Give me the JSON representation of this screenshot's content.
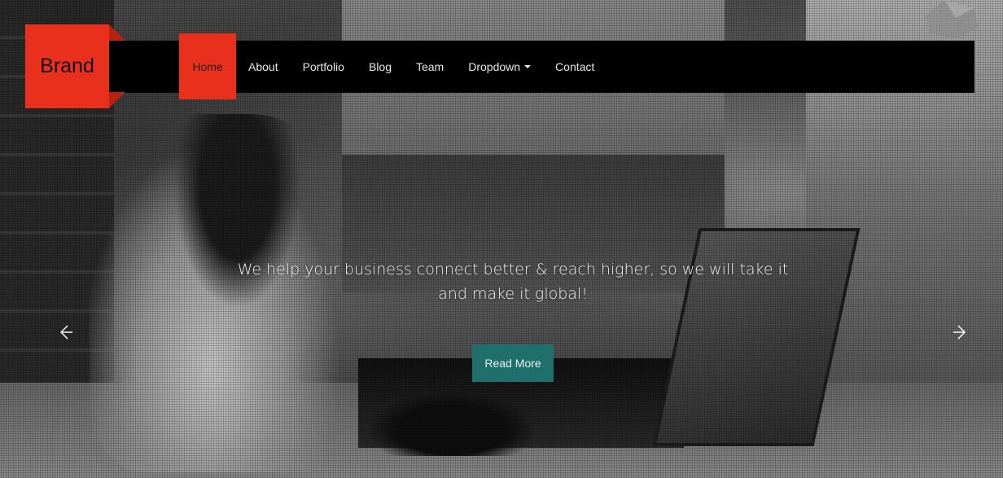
{
  "brand": {
    "label": "Brand",
    "color": "#e8301c"
  },
  "nav": {
    "items": [
      {
        "label": "Home",
        "active": true
      },
      {
        "label": "About",
        "active": false
      },
      {
        "label": "Portfolio",
        "active": false
      },
      {
        "label": "Blog",
        "active": false
      },
      {
        "label": "Team",
        "active": false
      },
      {
        "label": "Dropdown",
        "active": false,
        "has_caret": true
      },
      {
        "label": "Contact",
        "active": false
      }
    ]
  },
  "hero": {
    "caption": "We help your business connect better & reach higher, so we will take it and make it global!",
    "button_label": "Read More",
    "button_color": "#1f6f6d",
    "prev_icon": "chevron-left-icon",
    "next_icon": "chevron-right-icon"
  }
}
